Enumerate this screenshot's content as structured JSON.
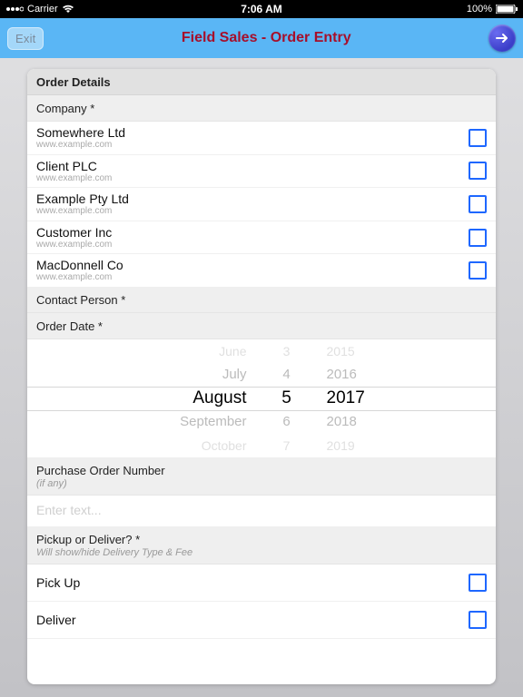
{
  "statusbar": {
    "carrier": "Carrier",
    "time": "7:06 AM",
    "battery": "100%"
  },
  "navbar": {
    "exit": "Exit",
    "title": "Field Sales - Order Entry"
  },
  "sections": {
    "order_details": "Order Details",
    "company": "Company *",
    "contact": "Contact Person *",
    "order_date": "Order Date *",
    "po": "Purchase Order Number",
    "po_sub": "(if any)",
    "pd": "Pickup or Deliver? *",
    "pd_sub": "Will show/hide Delivery Type & Fee"
  },
  "companies": [
    {
      "name": "Somewhere Ltd",
      "url": "www.example.com"
    },
    {
      "name": "Client PLC",
      "url": "www.example.com"
    },
    {
      "name": "Example Pty Ltd",
      "url": "www.example.com"
    },
    {
      "name": "Customer Inc",
      "url": "www.example.com"
    },
    {
      "name": "MacDonnell Co",
      "url": "www.example.com"
    }
  ],
  "picker": {
    "months": [
      "June",
      "July",
      "August",
      "September",
      "October"
    ],
    "days": [
      "3",
      "4",
      "5",
      "6",
      "7"
    ],
    "years": [
      "2015",
      "2016",
      "2017",
      "2018",
      "2019"
    ]
  },
  "po_placeholder": "Enter text...",
  "pd_options": {
    "pickup": "Pick Up",
    "deliver": "Deliver"
  }
}
